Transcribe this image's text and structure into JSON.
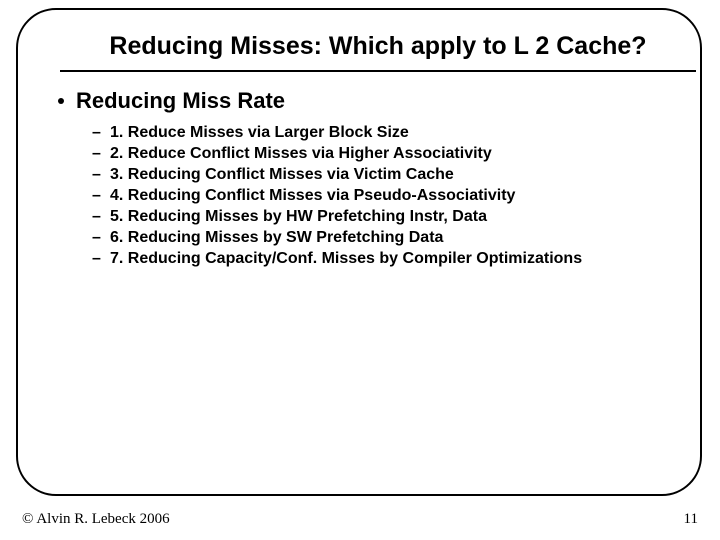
{
  "title": "Reducing Misses: Which apply to L 2 Cache?",
  "subhead": "Reducing Miss Rate",
  "items": [
    "1. Reduce Misses via Larger Block Size",
    "2. Reduce Conflict Misses via Higher Associativity",
    "3. Reducing Conflict Misses via Victim Cache",
    "4. Reducing Conflict Misses via Pseudo-Associativity",
    "5. Reducing Misses by HW Prefetching Instr, Data",
    "6. Reducing Misses by SW Prefetching Data",
    "7. Reducing Capacity/Conf. Misses by Compiler Optimizations"
  ],
  "footer": {
    "copyright": "© Alvin R. Lebeck 2006",
    "page": "11"
  }
}
